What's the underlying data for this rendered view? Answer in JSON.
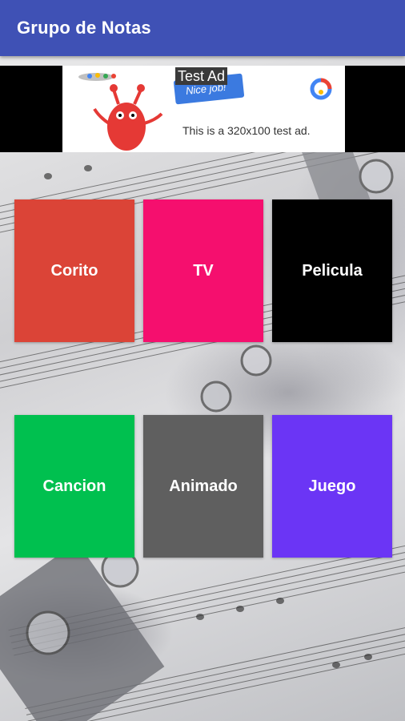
{
  "app_bar": {
    "title": "Grupo de Notas"
  },
  "ad": {
    "label": "Test Ad",
    "ribbon_text": "Nice job!",
    "description": "This is a 320x100 test ad."
  },
  "tiles": [
    {
      "label": "Corito",
      "color": "#db4437"
    },
    {
      "label": "TV",
      "color": "#f50f6e"
    },
    {
      "label": "Pelicula",
      "color": "#000000"
    },
    {
      "label": "Cancion",
      "color": "#00c04f"
    },
    {
      "label": "Animado",
      "color": "#5f5f5f"
    },
    {
      "label": "Juego",
      "color": "#6b35f5"
    }
  ],
  "colors": {
    "app_bar": "#3f51b5"
  }
}
